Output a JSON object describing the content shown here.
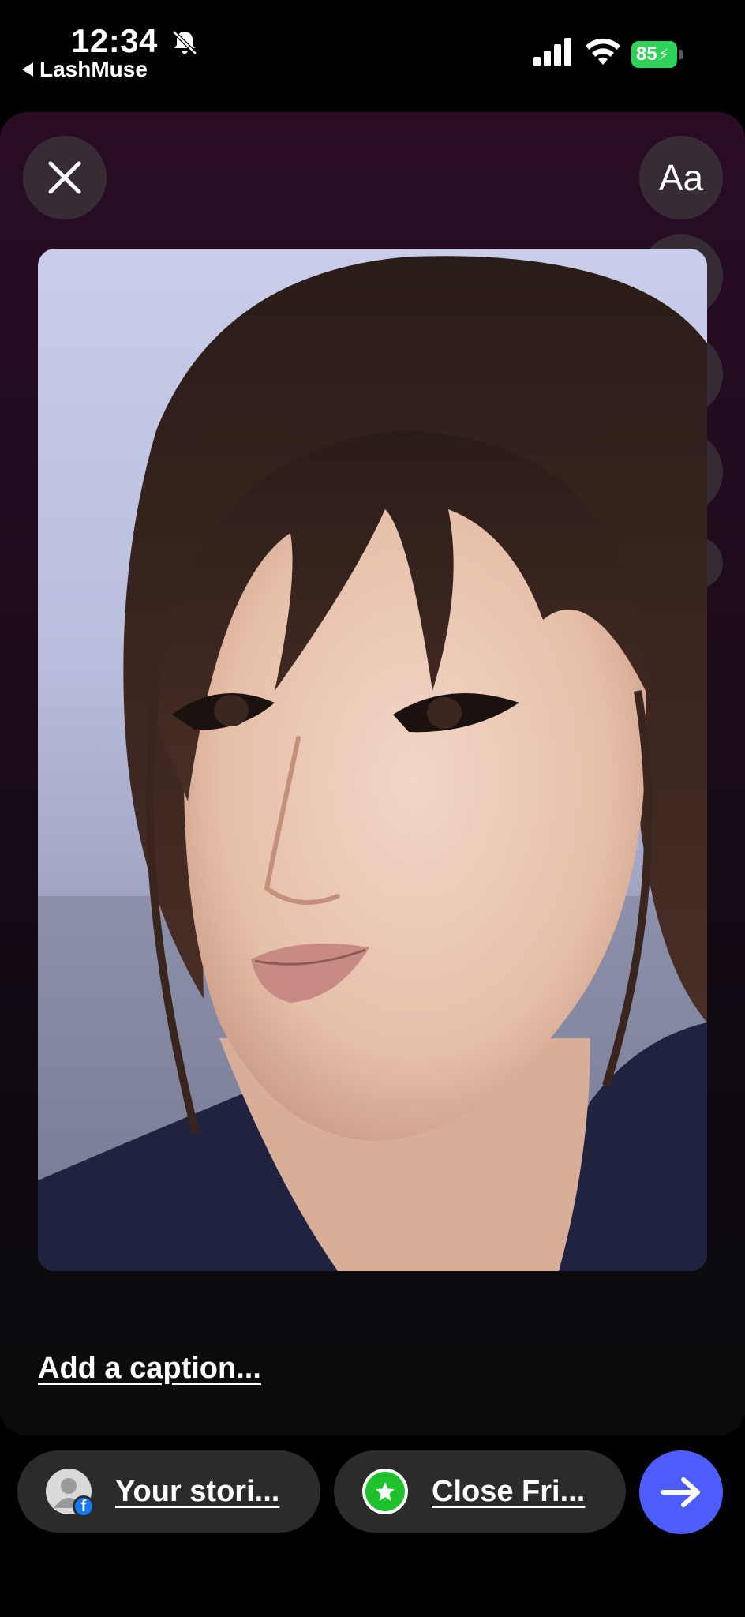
{
  "status_bar": {
    "time": "12:34",
    "back_app": "LashMuse",
    "battery": "85",
    "icons": [
      "bell-slash-icon",
      "signal-icon",
      "wifi-icon",
      "battery-charging-icon"
    ]
  },
  "editor": {
    "close_icon": "close-icon",
    "text_button_label": "Aa",
    "tools": [
      "sticker-icon",
      "music-note-icon",
      "sparkles-icon",
      "chevron-down-icon"
    ],
    "caption_placeholder": "Add a caption..."
  },
  "share_bar": {
    "your_stories_label": "Your stori...",
    "close_friends_label": "Close Fri...",
    "send_icon": "arrow-right-icon"
  },
  "colors": {
    "send_button": "#4c5dfb",
    "close_friends_badge": "#1fc22d",
    "battery": "#30d158",
    "facebook_badge": "#1877f2"
  }
}
